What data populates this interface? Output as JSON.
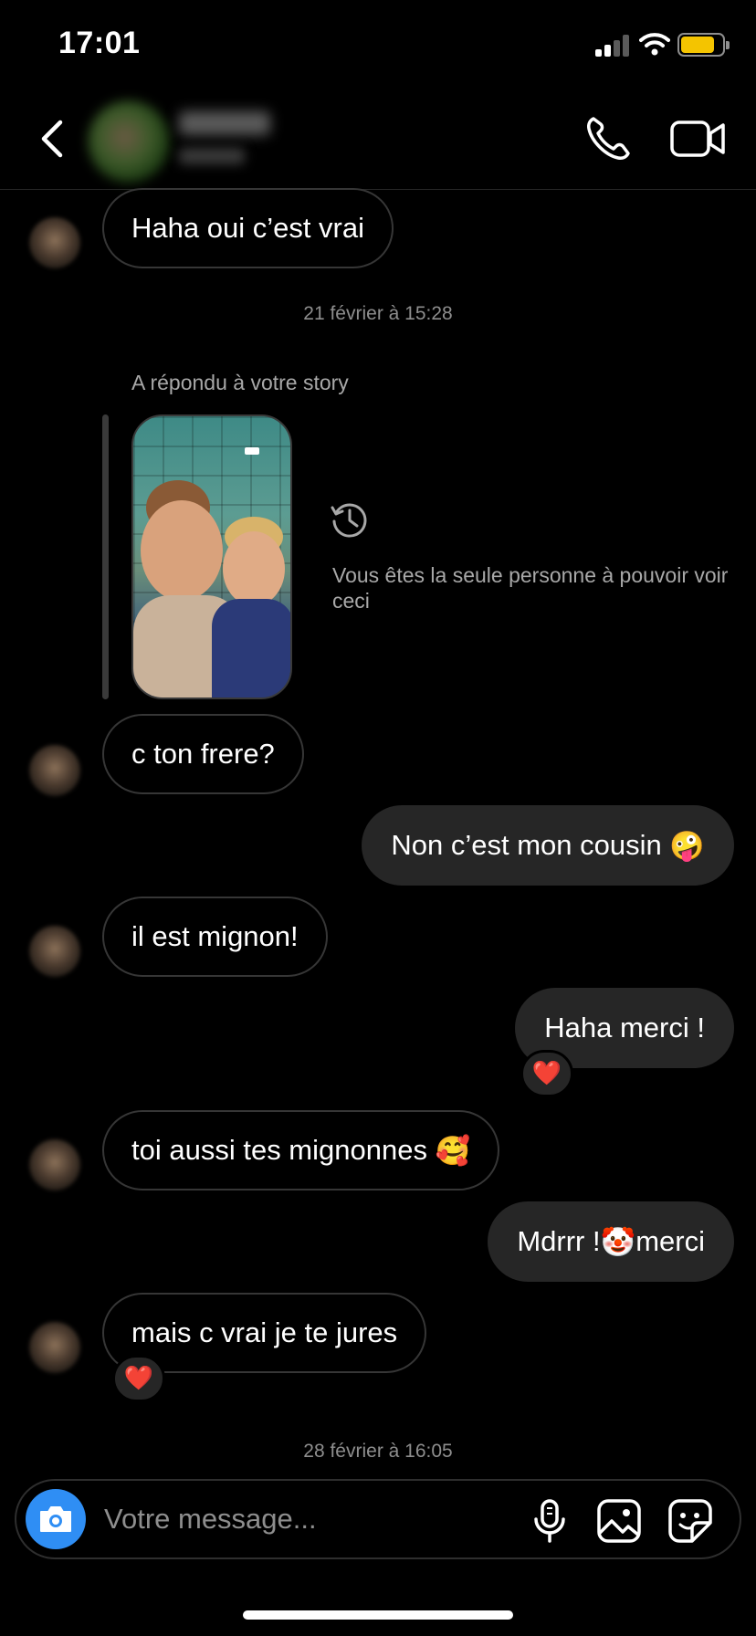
{
  "status_bar": {
    "time": "17:01"
  },
  "header": {
    "back_icon": "chevron-left-icon",
    "call_icon": "phone-icon",
    "video_icon": "video-camera-icon"
  },
  "messages": {
    "m1": "Haha oui c’est vrai",
    "ts1": "21 février à 15:28",
    "story_label": "A répondu à votre story",
    "story_note": "Vous êtes la seule personne à pouvoir voir ceci",
    "m2": "c ton frere?",
    "m3_text": "Non c’est mon cousin",
    "m3_emoji": "🤪",
    "m4": "il est mignon!",
    "m5": "Haha merci !",
    "m5_reaction": "❤️",
    "m6_text": "toi aussi tes mignonnes",
    "m6_emoji": "🥰",
    "m7_before": "Mdrrr !",
    "m7_emoji": "🤡",
    "m7_after": "merci",
    "m8": "mais c vrai je te jures",
    "m8_reaction": "❤️",
    "ts2": "28 février à 16:05"
  },
  "composer": {
    "placeholder": "Votre message..."
  },
  "colors": {
    "accent": "#2f8ef4",
    "battery": "#f4c400",
    "bubble_out": "#262626",
    "meta_text": "#8e8e8e"
  }
}
